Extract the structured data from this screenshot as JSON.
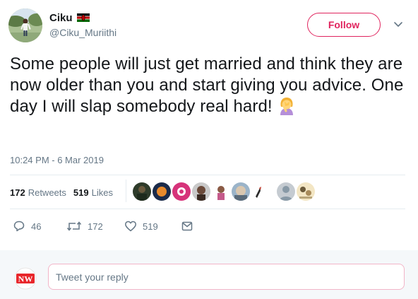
{
  "author": {
    "name": "Ciku",
    "handle": "@Ciku_Muriithi",
    "flag_icon": "kenya-flag-icon"
  },
  "follow_label": "Follow",
  "tweet": {
    "text": "Some people will just get married and think they are now older than you and start giving you advice. One day I will slap somebody real hard!",
    "emoji": "facepalm-emoji",
    "timestamp": "10:24 PM - 6 Mar 2019"
  },
  "stats": {
    "retweets_count": "172",
    "retweets_label": "Retweets",
    "likes_count": "519",
    "likes_label": "Likes"
  },
  "actions": {
    "replies": "46",
    "retweets": "172",
    "likes": "519"
  },
  "reply": {
    "placeholder": "Tweet your reply",
    "avatar_logo": "NW"
  },
  "colors": {
    "accent": "#e0245e",
    "secondary_text": "#657786",
    "divider": "#e6ecf0"
  }
}
